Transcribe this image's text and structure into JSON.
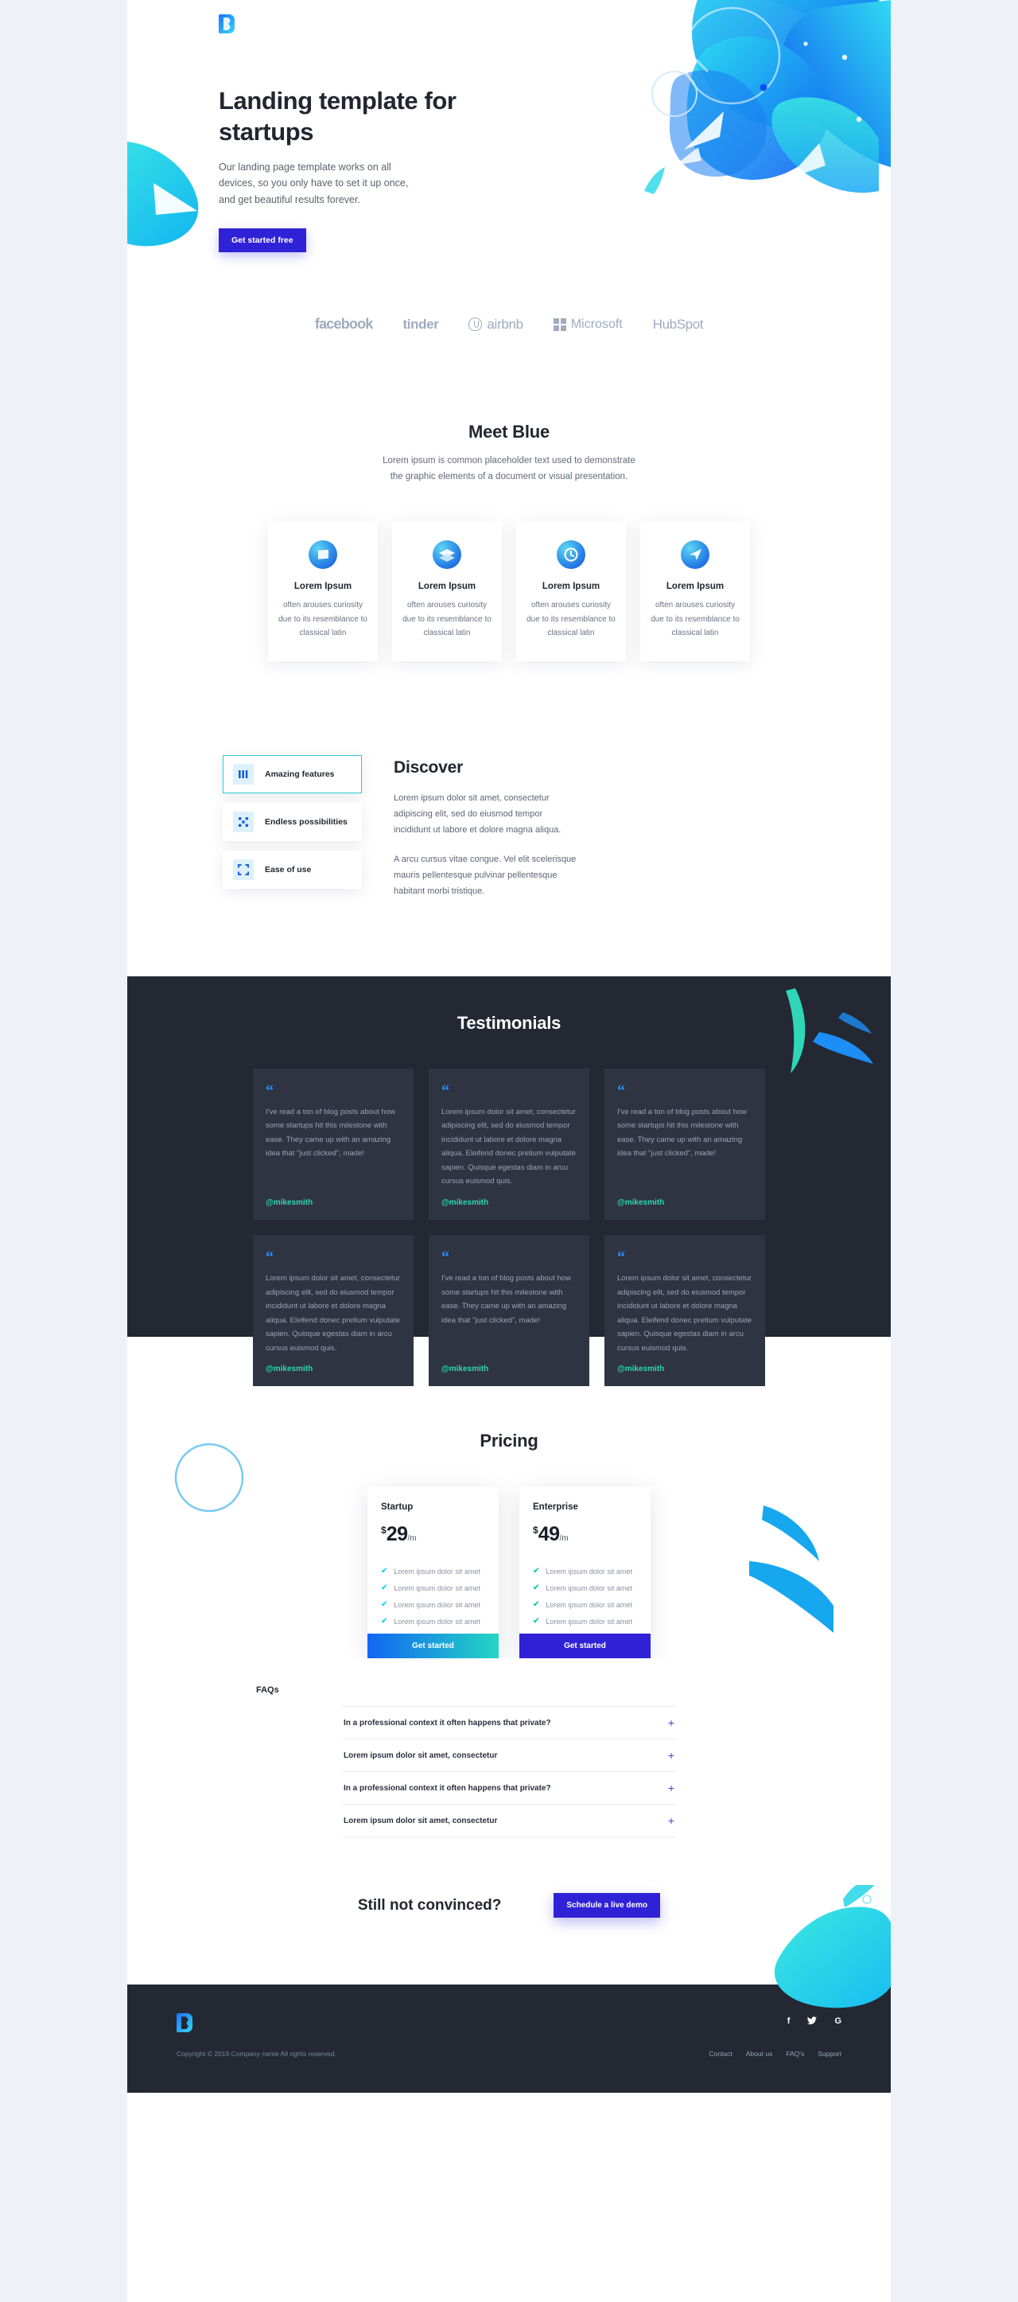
{
  "brand": {
    "logo_name": "blue-logo"
  },
  "hero": {
    "title": "Landing template for startups",
    "subtitle": "Our landing page template works on all devices, so you only have to set it up once, and get beautiful results forever.",
    "cta_label": "Get started free"
  },
  "logos": [
    {
      "name": "facebook",
      "label": "facebook"
    },
    {
      "name": "tinder",
      "label": "tinder"
    },
    {
      "name": "airbnb",
      "label": "airbnb"
    },
    {
      "name": "microsoft",
      "label": "Microsoft"
    },
    {
      "name": "hubspot",
      "label": "HubSpot"
    }
  ],
  "meet": {
    "title": "Meet Blue",
    "subtitle": "Lorem ipsum is common placeholder text used to demonstrate the graphic elements of a document or visual presentation.",
    "cards": [
      {
        "icon": "sphere-square-icon",
        "title": "Lorem Ipsum",
        "text": "often arouses curiosity due to its resemblance to classical latin"
      },
      {
        "icon": "sphere-layers-icon",
        "title": "Lorem Ipsum",
        "text": "often arouses curiosity due to its resemblance to classical latin"
      },
      {
        "icon": "sphere-clock-icon",
        "title": "Lorem Ipsum",
        "text": "often arouses curiosity due to its resemblance to classical latin"
      },
      {
        "icon": "sphere-send-icon",
        "title": "Lorem Ipsum",
        "text": "often arouses curiosity due to its resemblance to classical latin"
      }
    ]
  },
  "discover": {
    "features": [
      {
        "icon": "bars-icon",
        "label": "Amazing features",
        "active": true
      },
      {
        "icon": "scatter-icon",
        "label": "Endless possibilities",
        "active": false
      },
      {
        "icon": "expand-icon",
        "label": "Ease of use",
        "active": false
      }
    ],
    "title": "Discover",
    "paragraph1": "Lorem ipsum dolor sit amet, consectetur adipiscing elit, sed do eiusmod tempor incididunt ut labore et dolore magna aliqua.",
    "paragraph2": "A arcu cursus vitae congue. Vel elit scelerisque mauris pellentesque pulvinar pellentesque habitant morbi tristique."
  },
  "testimonials": {
    "title": "Testimonials",
    "quote_mark": "“",
    "items": [
      {
        "text": "I've read a ton of blog posts about how some startups hit this milestone with ease. They came up with an amazing idea that \"just clicked\", made!",
        "handle": "@mikesmith"
      },
      {
        "text": "Lorem ipsum dolor sit amet, consectetur adipiscing elit, sed do eiusmod tempor incididunt ut labore et dolore magna aliqua. Eleifend donec pretium vulputate sapien. Quisque egestas diam in arcu cursus euismod quis.",
        "handle": "@mikesmith"
      },
      {
        "text": "I've read a ton of blog posts about how some startups hit this milestone with ease. They came up with an amazing idea that \"just clicked\", made!",
        "handle": "@mikesmith"
      },
      {
        "text": "Lorem ipsum dolor sit amet, consectetur adipiscing elit, sed do eiusmod tempor incididunt ut labore et dolore magna aliqua. Eleifend donec pretium vulputate sapien. Quisque egestas diam in arcu cursus euismod quis.",
        "handle": "@mikesmith"
      },
      {
        "text": "I've read a ton of blog posts about how some startups hit this milestone with ease. They came up with an amazing idea that \"just clicked\", made!",
        "handle": "@mikesmith"
      },
      {
        "text": "Lorem ipsum dolor sit amet, consectetur adipiscing elit, sed do eiusmod tempor incididunt ut labore et dolore magna aliqua. Eleifend donec pretium vulputate sapien. Quisque egestas diam in arcu cursus euismod quis.",
        "handle": "@mikesmith"
      }
    ]
  },
  "pricing": {
    "title": "Pricing",
    "plans": [
      {
        "name": "Startup",
        "currency": "$",
        "amount": "29",
        "period": "/m",
        "features": [
          "Lorem ipsum dolor sit amet",
          "Lorem ipsum dolor sit amet",
          "Lorem ipsum dolor sit amet",
          "Lorem ipsum dolor sit amet"
        ],
        "check": "✔",
        "check_color": "#2fd4e8",
        "cta_label": "Get started",
        "cta_style": "gradient"
      },
      {
        "name": "Enterprise",
        "currency": "$",
        "amount": "49",
        "period": "/m",
        "features": [
          "Lorem ipsum dolor sit amet",
          "Lorem ipsum dolor sit amet",
          "Lorem ipsum dolor sit amet",
          "Lorem ipsum dolor sit amet"
        ],
        "check": "✔",
        "check_color": "#21c9a8",
        "cta_label": "Get started",
        "cta_style": "solid"
      }
    ]
  },
  "faqs": {
    "title": "FAQs",
    "expand_icon": "+",
    "items": [
      {
        "question": "In a professional context it often happens that private?"
      },
      {
        "question": "Lorem ipsum dolor sit amet, consectetur"
      },
      {
        "question": "In a professional context it often happens that private?"
      },
      {
        "question": "Lorem ipsum dolor sit amet, consectetur"
      }
    ]
  },
  "cta": {
    "title": "Still not convinced?",
    "button_label": "Schedule a live demo"
  },
  "footer": {
    "logo_name": "blue-logo",
    "socials": [
      {
        "name": "facebook-icon",
        "glyph": "f"
      },
      {
        "name": "twitter-icon",
        "glyph": "🐦"
      },
      {
        "name": "google-icon",
        "glyph": "G"
      }
    ],
    "copyright": "Copyright © 2019.Company name All rights reserved.",
    "links": [
      {
        "label": "Contact"
      },
      {
        "label": "About us"
      },
      {
        "label": "FAQ's"
      },
      {
        "label": "Support"
      }
    ]
  },
  "colors": {
    "accent_blue": "#2f22d6",
    "cyan": "#2fd6c4",
    "dark": "#232833",
    "card_dark": "#2e3442",
    "text_dark": "#232630",
    "text_muted": "#6b7283"
  }
}
